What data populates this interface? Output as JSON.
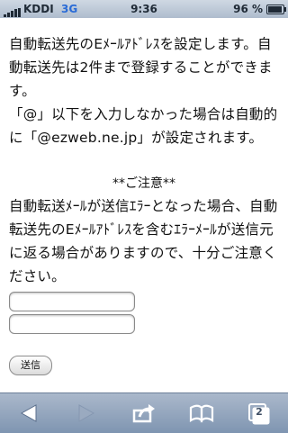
{
  "status_bar": {
    "carrier": "KDDI",
    "network": "3G",
    "time": "9:36",
    "battery_text": "96 %",
    "battery_level": 0.96
  },
  "content": {
    "paragraph1": "自動転送先のEﾒｰﾙｱﾄﾞﾚｽを設定します。自動転送先は2件まで登録することができます。",
    "paragraph2": "「@」以下を入力しなかった場合は自動的に「@ezweb.ne.jp」が設定されます。",
    "notice_heading": "**ご注意**",
    "paragraph3": "自動転送ﾒｰﾙが送信ｴﾗｰとなった場合、自動転送先のEﾒｰﾙｱﾄﾞﾚｽを含むｴﾗｰﾒｰﾙが送信元に返る場合がありますので、十分ご注意ください。",
    "address_field_1": "",
    "address_field_2": "",
    "send_button_label": "送信"
  },
  "toolbar": {
    "pages_count": "2",
    "icons": [
      "back-icon",
      "forward-icon",
      "share-icon",
      "bookmarks-icon",
      "pages-icon"
    ]
  }
}
